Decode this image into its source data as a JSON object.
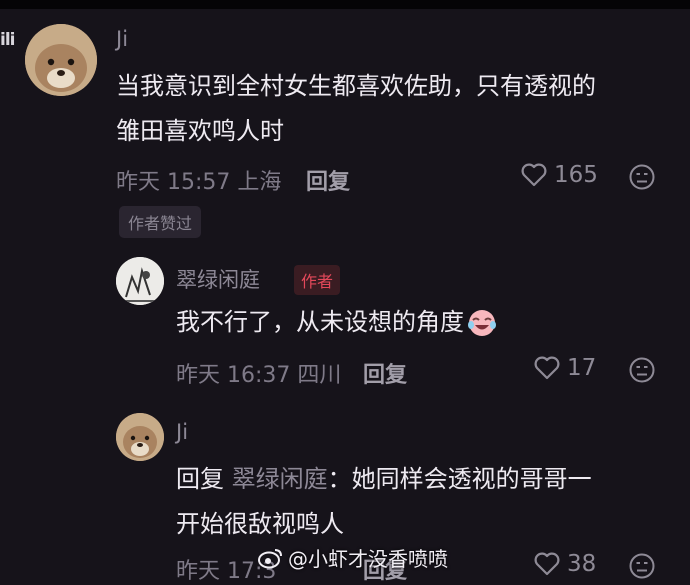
{
  "left_fragment": "ili",
  "comment": {
    "user": "Ji",
    "text_line1": "当我意识到全村女生都喜欢佐助，只有透视的",
    "text_line2": "雏田喜欢鸣人时",
    "meta": "昨天 15:57 上海",
    "reply_label": "回复",
    "likes": "165",
    "author_liked_badge": "作者赞过"
  },
  "reply1": {
    "user": "翠绿闲庭",
    "author_tag": "作者",
    "text": "我不行了，从未设想的角度",
    "meta": "昨天 16:37 四川",
    "reply_label": "回复",
    "likes": "17"
  },
  "reply2": {
    "user": "Ji",
    "reply_prefix": "回复",
    "reply_target": "翠绿闲庭",
    "text_line1": "：她同样会透视的哥哥一",
    "text_line2": "开始很敌视鸣人",
    "meta": "昨天 17:3",
    "reply_label": "回复",
    "likes": "38"
  },
  "watermark": "@小虾才没香喷喷"
}
